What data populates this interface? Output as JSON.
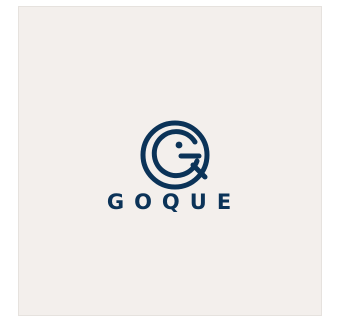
{
  "logo": {
    "brand_name": "GOQUE",
    "icon": "g-q-monogram-icon",
    "color": "#0b3358"
  },
  "colors": {
    "background": "#f3efec",
    "page": "#ffffff",
    "frame_border": "#e6e2de"
  }
}
